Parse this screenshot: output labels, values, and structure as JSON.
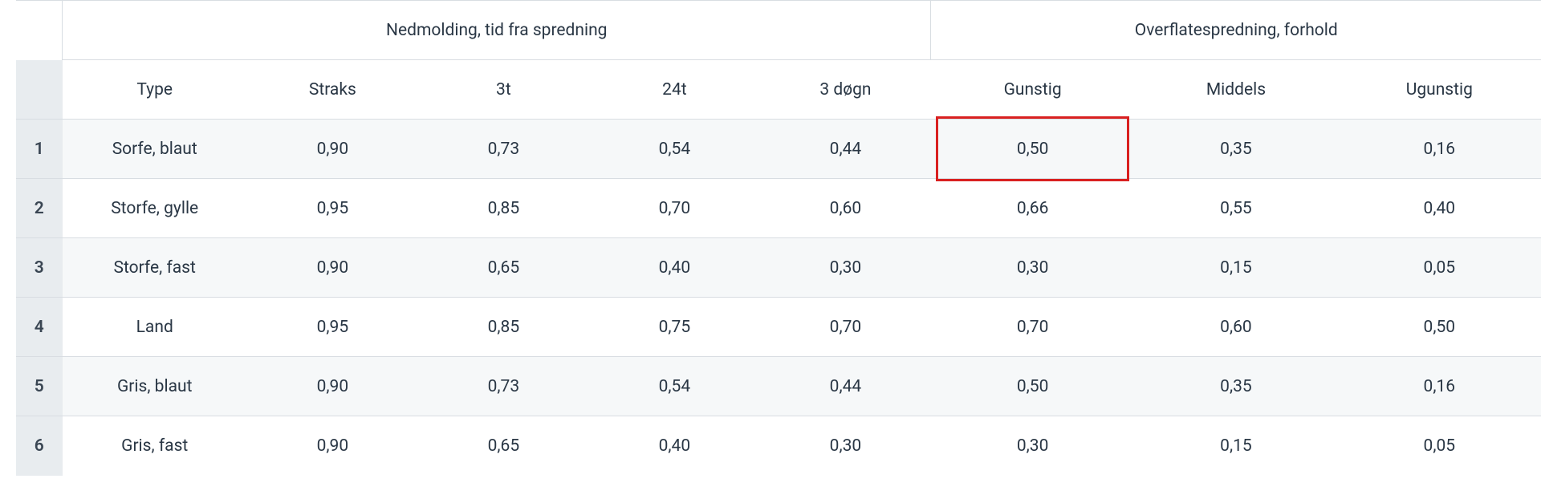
{
  "table": {
    "groupHeaders": {
      "left": "Nedmolding, tid fra spredning",
      "right": "Overflatespredning, forhold"
    },
    "columns": {
      "type": "Type",
      "straks": "Straks",
      "t3": "3t",
      "t24": "24t",
      "d3": "3 døgn",
      "gunstig": "Gunstig",
      "middels": "Middels",
      "ugunstig": "Ugunstig"
    },
    "rows": [
      {
        "num": "1",
        "type": "Sorfe, blaut",
        "straks": "0,90",
        "t3": "0,73",
        "t24": "0,54",
        "d3": "0,44",
        "gunstig": "0,50",
        "middels": "0,35",
        "ugunstig": "0,16"
      },
      {
        "num": "2",
        "type": "Storfe, gylle",
        "straks": "0,95",
        "t3": "0,85",
        "t24": "0,70",
        "d3": "0,60",
        "gunstig": "0,66",
        "middels": "0,55",
        "ugunstig": "0,40"
      },
      {
        "num": "3",
        "type": "Storfe, fast",
        "straks": "0,90",
        "t3": "0,65",
        "t24": "0,40",
        "d3": "0,30",
        "gunstig": "0,30",
        "middels": "0,15",
        "ugunstig": "0,05"
      },
      {
        "num": "4",
        "type": "Land",
        "straks": "0,95",
        "t3": "0,85",
        "t24": "0,75",
        "d3": "0,70",
        "gunstig": "0,70",
        "middels": "0,60",
        "ugunstig": "0,50"
      },
      {
        "num": "5",
        "type": "Gris, blaut",
        "straks": "0,90",
        "t3": "0,73",
        "t24": "0,54",
        "d3": "0,44",
        "gunstig": "0,50",
        "middels": "0,35",
        "ugunstig": "0,16"
      },
      {
        "num": "6",
        "type": "Gris, fast",
        "straks": "0,90",
        "t3": "0,65",
        "t24": "0,40",
        "d3": "0,30",
        "gunstig": "0,30",
        "middels": "0,15",
        "ugunstig": "0,05"
      }
    ],
    "highlight": {
      "row": 0,
      "col": "gunstig"
    }
  }
}
